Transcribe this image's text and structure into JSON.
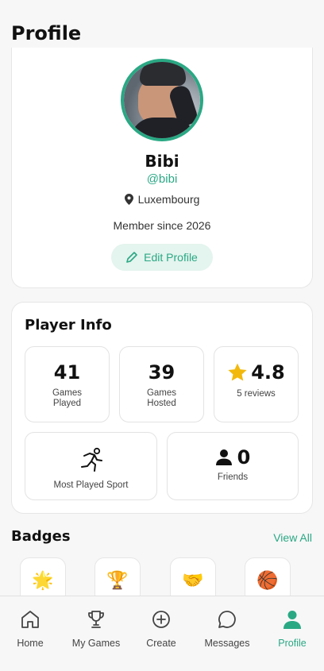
{
  "page": {
    "title": "Profile"
  },
  "profile": {
    "name": "Bibi",
    "handle": "@bibi",
    "location": "Luxembourg",
    "member_since": "Member since 2026",
    "edit_label": "Edit Profile",
    "accent_color": "#2aa884"
  },
  "player_info": {
    "title": "Player Info",
    "games_played": {
      "value": "41",
      "label_line1": "Games",
      "label_line2": "Played"
    },
    "games_hosted": {
      "value": "39",
      "label_line1": "Games",
      "label_line2": "Hosted"
    },
    "rating": {
      "value": "4.8",
      "label": "5 reviews",
      "icon": "star-icon"
    },
    "most_played_sport": {
      "label": "Most Played Sport",
      "icon": "runner-icon"
    },
    "friends": {
      "value": "0",
      "label": "Friends",
      "icon": "person-icon"
    }
  },
  "badges": {
    "title": "Badges",
    "view_all": "View All",
    "items": [
      {
        "icon": "star-badge-icon",
        "glyph": "🌟"
      },
      {
        "icon": "trophy-badge-icon",
        "glyph": "🏆"
      },
      {
        "icon": "handshake-badge-icon",
        "glyph": "🤝"
      },
      {
        "icon": "basketball-badge-icon",
        "glyph": "🏀"
      }
    ]
  },
  "tabbar": {
    "items": [
      {
        "label": "Home",
        "icon": "home-icon"
      },
      {
        "label": "My Games",
        "icon": "trophy-icon"
      },
      {
        "label": "Create",
        "icon": "plus-circle-icon"
      },
      {
        "label": "Messages",
        "icon": "chat-icon"
      },
      {
        "label": "Profile",
        "icon": "person-icon",
        "active": true
      }
    ]
  }
}
